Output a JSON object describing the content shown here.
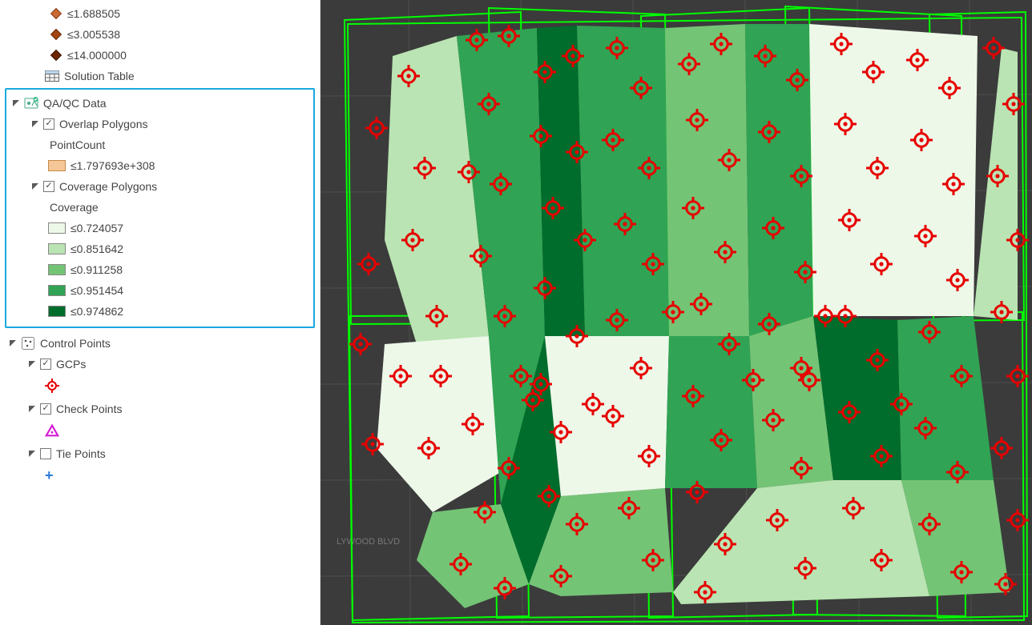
{
  "toc": {
    "topBreaks": [
      "≤1.688505",
      "≤3.005538",
      "≤14.000000"
    ],
    "solutionTable": "Solution Table",
    "qaGroup": "QA/QC Data",
    "overlapPolygons": "Overlap Polygons",
    "pointCount": "PointCount",
    "pointCountBreak": "≤1.797693e+308",
    "coveragePolygons": "Coverage Polygons",
    "coverage": "Coverage",
    "coverageBreaks": [
      "≤0.724057",
      "≤0.851642",
      "≤0.911258",
      "≤0.951454",
      "≤0.974862"
    ],
    "coverageColors": [
      "#edf8e9",
      "#bae4b3",
      "#74c476",
      "#31a354",
      "#006d2c"
    ],
    "controlPointsGroup": "Control Points",
    "gcps": "GCPs",
    "checkPoints": "Check Points",
    "tiePoints": "Tie Points"
  },
  "map": {
    "basemapLabels": [
      "Hollywood",
      "LYWOOD BLVD"
    ]
  }
}
